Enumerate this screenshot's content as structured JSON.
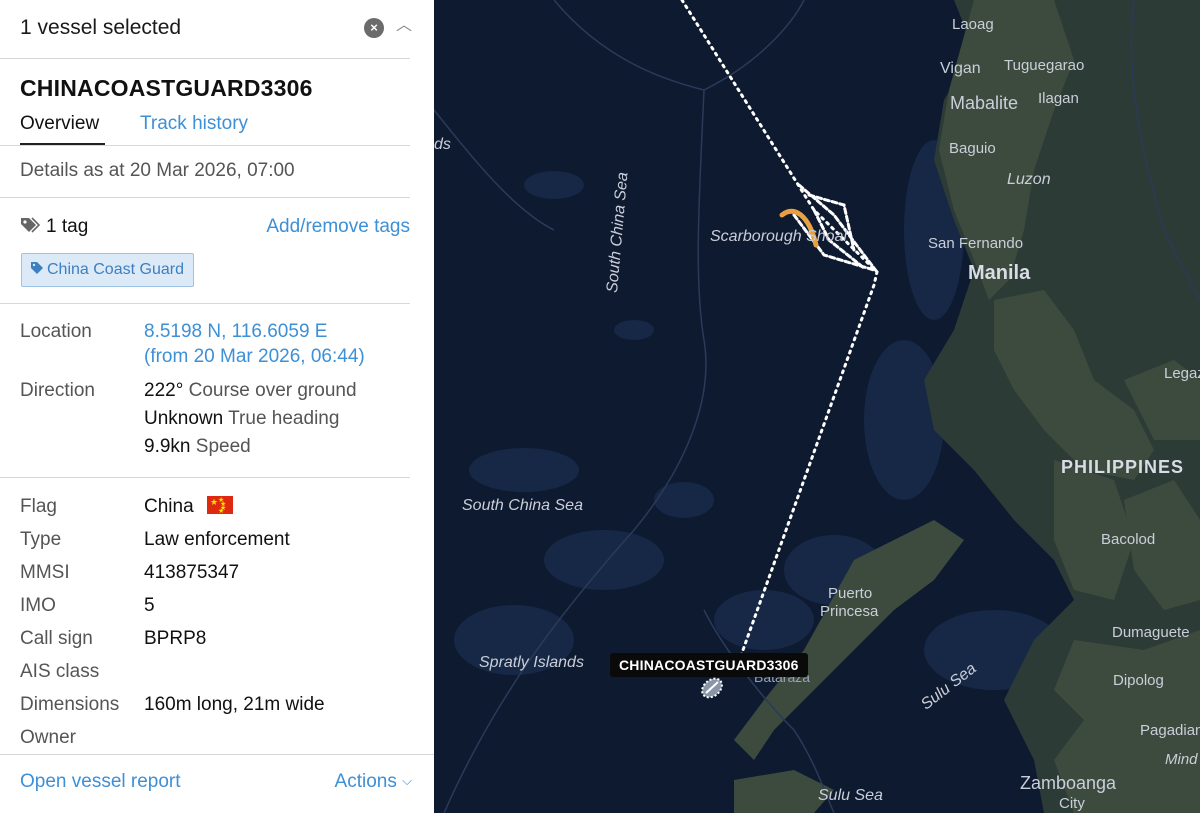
{
  "panel": {
    "header_title": "1 vessel selected",
    "vessel_name": "CHINACOASTGUARD3306",
    "tabs": [
      {
        "label": "Overview",
        "active": true
      },
      {
        "label": "Track history",
        "active": false
      }
    ],
    "details_as": "Details as at 20 Mar 2026, 07:00",
    "tag_count": "1 tag",
    "add_remove_tags": "Add/remove tags",
    "tags": [
      "China Coast Guard"
    ],
    "location": {
      "label": "Location",
      "coords": "8.5198 N, 116.6059 E",
      "since": "(from 20 Mar 2026, 06:44)"
    },
    "direction": {
      "label": "Direction",
      "course_value": "222°",
      "course_label": "Course over ground",
      "heading_value": "Unknown",
      "heading_label": "True heading",
      "speed_value": "9.9kn",
      "speed_label": "Speed"
    },
    "fields": [
      {
        "key": "flag",
        "label": "Flag",
        "value": "China"
      },
      {
        "key": "type",
        "label": "Type",
        "value": "Law enforcement"
      },
      {
        "key": "mmsi",
        "label": "MMSI",
        "value": "413875347"
      },
      {
        "key": "imo",
        "label": "IMO",
        "value": "5"
      },
      {
        "key": "callsign",
        "label": "Call sign",
        "value": "BPRP8"
      },
      {
        "key": "ais",
        "label": "AIS class",
        "value": ""
      },
      {
        "key": "dimensions",
        "label": "Dimensions",
        "value": "160m long, 21m wide"
      },
      {
        "key": "owner",
        "label": "Owner",
        "value": ""
      }
    ],
    "footer": {
      "open_report": "Open vessel report",
      "actions": "Actions"
    },
    "colors": {
      "link": "#3d8fd6",
      "chip_bg": "#dce9f6",
      "flag_red": "#de2910"
    },
    "icons": {
      "close": "close-icon",
      "collapse": "chevron-up-icon",
      "tag": "tag-icon",
      "actions_chevron": "chevron-down-icon"
    }
  },
  "map": {
    "vessel_label": "CHINACOASTGUARD3306",
    "labels": {
      "laoag": "Laoag",
      "vigan": "Vigan",
      "tuguegarao": "Tuguegarao",
      "mabalite": "Mabalite",
      "ilagan": "Ilagan",
      "baguio": "Baguio",
      "luzon": "Luzon",
      "san_fernando": "San Fernando",
      "manila": "Manila",
      "legaz": "Legaz",
      "philippines": "PHILIPPINES",
      "bacolod": "Bacolod",
      "dumaguete": "Dumaguete",
      "dipolog": "Dipolog",
      "pagadian": "Pagadian",
      "mind": "Mind",
      "zamboanga": "Zamboanga",
      "city": "City",
      "sulu_sea": "Sulu Sea",
      "sulu_sea_2": "Sulu Sea",
      "puerto": "Puerto",
      "princesa": "Princesa",
      "bataraza": "Bataraza",
      "spratly": "Spratly Islands",
      "south_china_sea": "South China Sea",
      "south_china_sea_v": "South China Sea",
      "scarborough": "Scarborough Shoal",
      "ds": "ds"
    },
    "colors": {
      "sea": "#0e1a30",
      "land": "#3c4a3e",
      "track": "#ffffff",
      "track_recent": "#e8a040"
    }
  }
}
